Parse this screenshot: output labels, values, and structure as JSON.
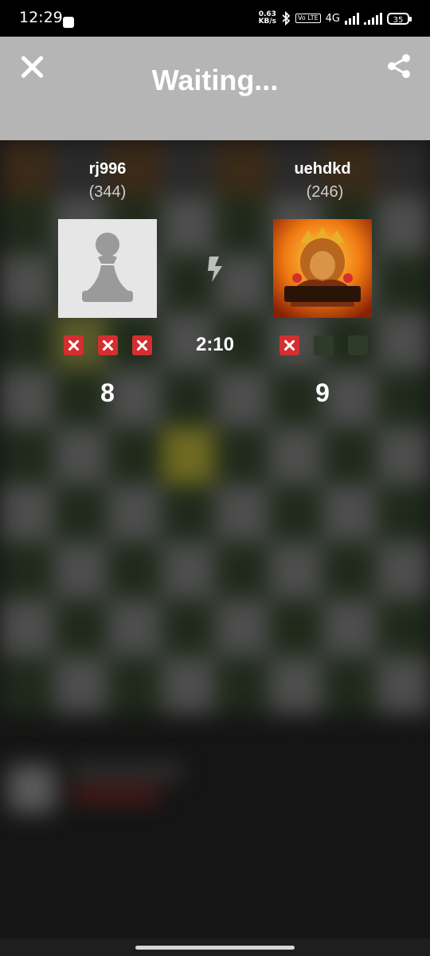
{
  "status_bar": {
    "time": "12:29",
    "net_speed_value": "0.63",
    "net_speed_unit": "KB/s",
    "volte": "Vo LTE",
    "network": "4G",
    "battery": "35"
  },
  "header": {
    "title": "Waiting...",
    "close_icon": "close-icon",
    "share_icon": "share-icon"
  },
  "match": {
    "timer": "2:10",
    "mode_icon": "bolt-icon",
    "player1": {
      "name": "rj996",
      "rating": "(344)",
      "score": "8",
      "marks": [
        "x",
        "x",
        "x"
      ]
    },
    "player2": {
      "name": "uehdkd",
      "rating": "(246)",
      "score": "9",
      "marks": [
        "x",
        "empty",
        "empty"
      ]
    }
  },
  "colors": {
    "header_bg": "#b5b5b5",
    "mark_red": "#d32f2f",
    "background": "#151515"
  }
}
